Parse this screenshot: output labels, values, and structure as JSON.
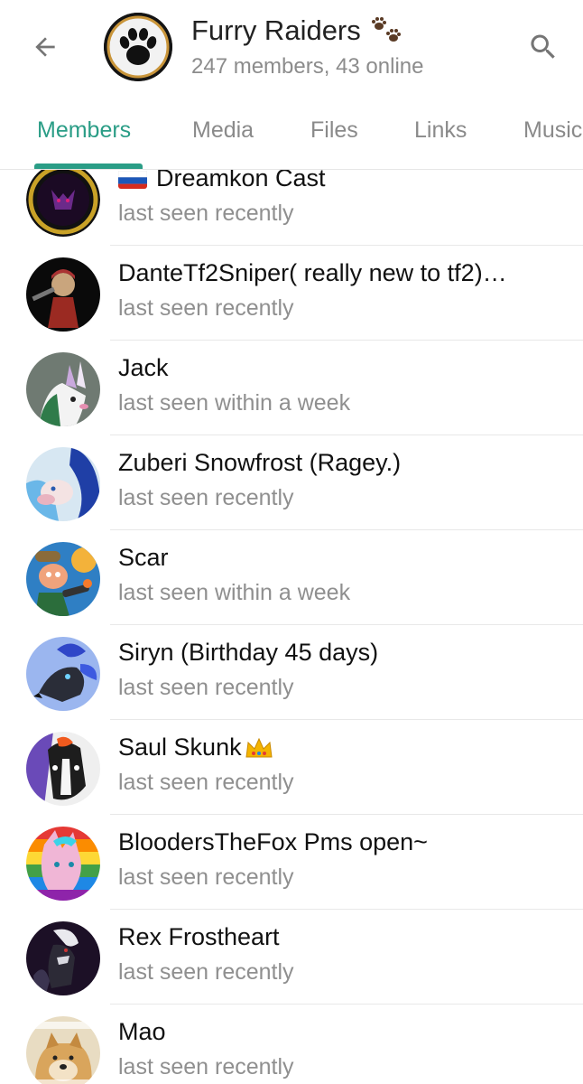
{
  "header": {
    "title": "Furry Raiders",
    "subtitle": "247 members, 43 online",
    "icons": {
      "back": "arrow-left-icon",
      "search": "search-icon",
      "title_emoji": "paw-prints-emoji"
    }
  },
  "tabs": [
    {
      "label": "Members",
      "active": true
    },
    {
      "label": "Media",
      "active": false
    },
    {
      "label": "Files",
      "active": false
    },
    {
      "label": "Links",
      "active": false
    },
    {
      "label": "Music",
      "active": false
    }
  ],
  "colors": {
    "accent": "#2a9d86",
    "status_text": "#8f8f8f",
    "divider": "#e8e8e8"
  },
  "members": [
    {
      "name": "Dreamkon Cast",
      "status": "last seen recently",
      "emoji_prefix": "russia-flag"
    },
    {
      "name": "DanteTf2Sniper( really new to tf2)…",
      "status": "last seen recently"
    },
    {
      "name": "Jack",
      "status": "last seen within a week"
    },
    {
      "name": "Zuberi Snowfrost (Ragey.)",
      "status": "last seen recently"
    },
    {
      "name": "Scar",
      "status": "last seen within a week"
    },
    {
      "name": "Siryn (Birthday 45 days)",
      "status": "last seen recently"
    },
    {
      "name": "Saul Skunk",
      "status": "last seen recently",
      "emoji_suffix": "crown"
    },
    {
      "name": "BloodersTheFox Pms open~",
      "status": "last seen recently"
    },
    {
      "name": "Rex Frostheart",
      "status": "last seen recently"
    },
    {
      "name": "Mao",
      "status": "last seen recently"
    }
  ]
}
